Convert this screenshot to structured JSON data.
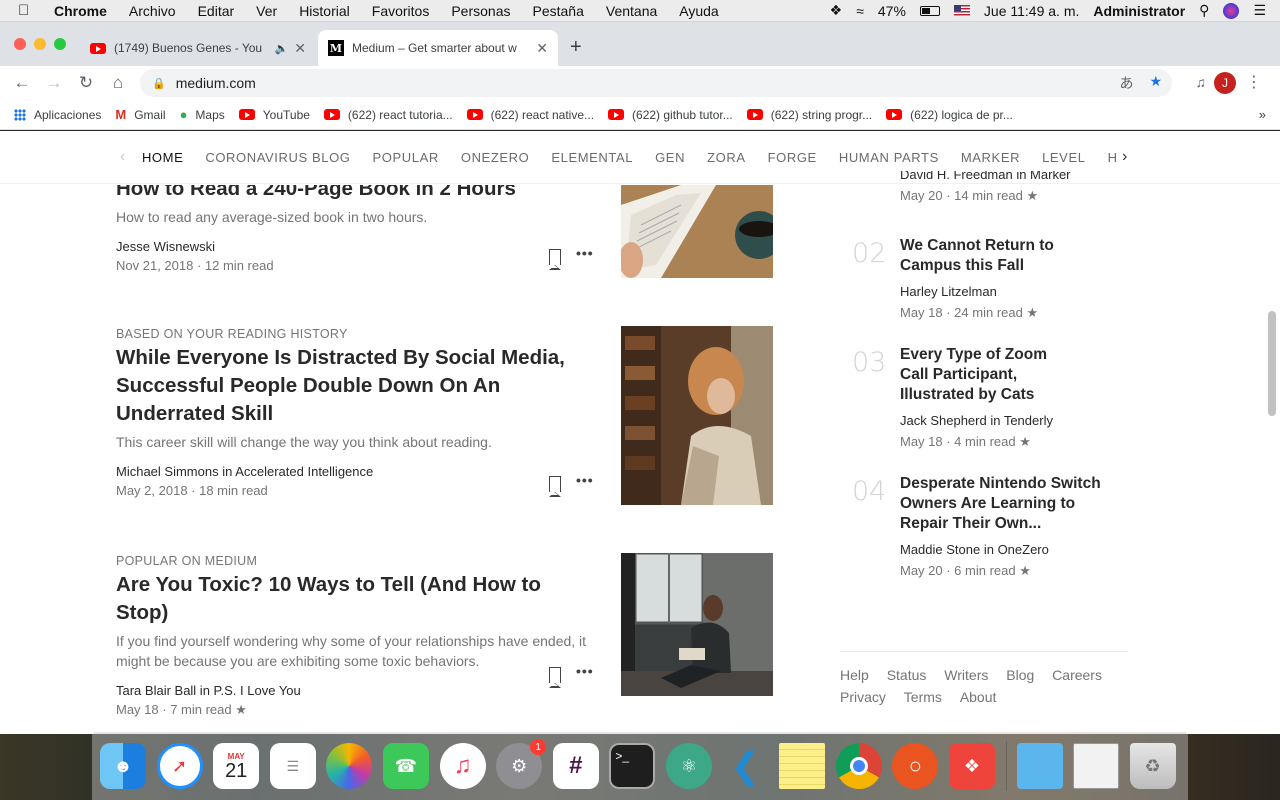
{
  "menubar": {
    "items": [
      "Chrome",
      "Archivo",
      "Editar",
      "Ver",
      "Historial",
      "Favoritos",
      "Personas",
      "Pestaña",
      "Ventana",
      "Ayuda"
    ],
    "battery": "47%",
    "clock": "Jue 11:49 a. m.",
    "user": "Administrator"
  },
  "tabs": [
    {
      "title": "(1749) Buenos Genes - You",
      "icon": "youtube-icon"
    },
    {
      "title": "Medium – Get smarter about w",
      "icon": "medium-icon"
    }
  ],
  "omnibox": {
    "url": "medium.com"
  },
  "profile_initial": "J",
  "bookmarks": [
    {
      "label": "Aplicaciones",
      "icon": "apps-grid-icon"
    },
    {
      "label": "Gmail",
      "icon": "gmail-icon"
    },
    {
      "label": "Maps",
      "icon": "maps-icon"
    },
    {
      "label": "YouTube",
      "icon": "youtube-icon"
    },
    {
      "label": "(622) react tutoria...",
      "icon": "youtube-icon"
    },
    {
      "label": "(622) react native...",
      "icon": "youtube-icon"
    },
    {
      "label": "(622) github tutor...",
      "icon": "youtube-icon"
    },
    {
      "label": "(622) string progr...",
      "icon": "youtube-icon"
    },
    {
      "label": "(622) logica de pr...",
      "icon": "youtube-icon"
    }
  ],
  "topics": [
    "HOME",
    "CORONAVIRUS BLOG",
    "POPULAR",
    "ONEZERO",
    "ELEMENTAL",
    "GEN",
    "ZORA",
    "FORGE",
    "HUMAN PARTS",
    "MARKER",
    "LEVEL",
    "H"
  ],
  "articles": [
    {
      "kicker": "",
      "headline": "How to Read a 240-Page Book in 2 Hours",
      "sub": "How to read any average-sized book in two hours.",
      "author": "Jesse Wisnewski",
      "date": "Nov 21, 2018",
      "read": "12 min read",
      "star": ""
    },
    {
      "kicker": "BASED ON YOUR READING HISTORY",
      "headline": "While Everyone Is Distracted By Social Media, Successful People Double Down On An Underrated Skill",
      "sub": "This career skill will change the way you think about reading.",
      "author": "Michael Simmons in Accelerated Intelligence",
      "date": "May 2, 2018",
      "read": "18 min read",
      "star": ""
    },
    {
      "kicker": "POPULAR ON MEDIUM",
      "headline": "Are You Toxic? 10 Ways to Tell (And How to Stop)",
      "sub": "If you find yourself wondering why some of your relationships have ended, it might be because you are exhibiting some toxic behaviors.",
      "author": "Tara Blair Ball in P.S. I Love You",
      "date": "May 18",
      "read": "7 min read",
      "star": "★"
    }
  ],
  "sidebar": {
    "partial_author": "David H. Freedman in Marker",
    "partial_meta": "May 20 · 14 min read ★",
    "items": [
      {
        "num": "02",
        "title": "We Cannot Return to Campus this Fall",
        "author": "Harley Litzelman",
        "meta": "May 18 · 24 min read ★"
      },
      {
        "num": "03",
        "title": "Every Type of Zoom Call Participant, Illustrated by Cats",
        "author": "Jack Shepherd in Tenderly",
        "meta": "May 18 · 4 min read ★"
      },
      {
        "num": "04",
        "title": "Desperate Nintendo Switch Owners Are Learning to Repair Their Own...",
        "author": "Maddie Stone in OneZero",
        "meta": "May 20 · 6 min read ★"
      }
    ]
  },
  "footer": [
    "Help",
    "Status",
    "Writers",
    "Blog",
    "Careers",
    "Privacy",
    "Terms",
    "About"
  ],
  "dock": {
    "calendar_month": "MAY",
    "calendar_day": "21",
    "settings_badge": "1"
  },
  "colors": {
    "youtube": "#ff0000",
    "chrome_accent": "#1a73e8",
    "profile": "#c5221f"
  }
}
